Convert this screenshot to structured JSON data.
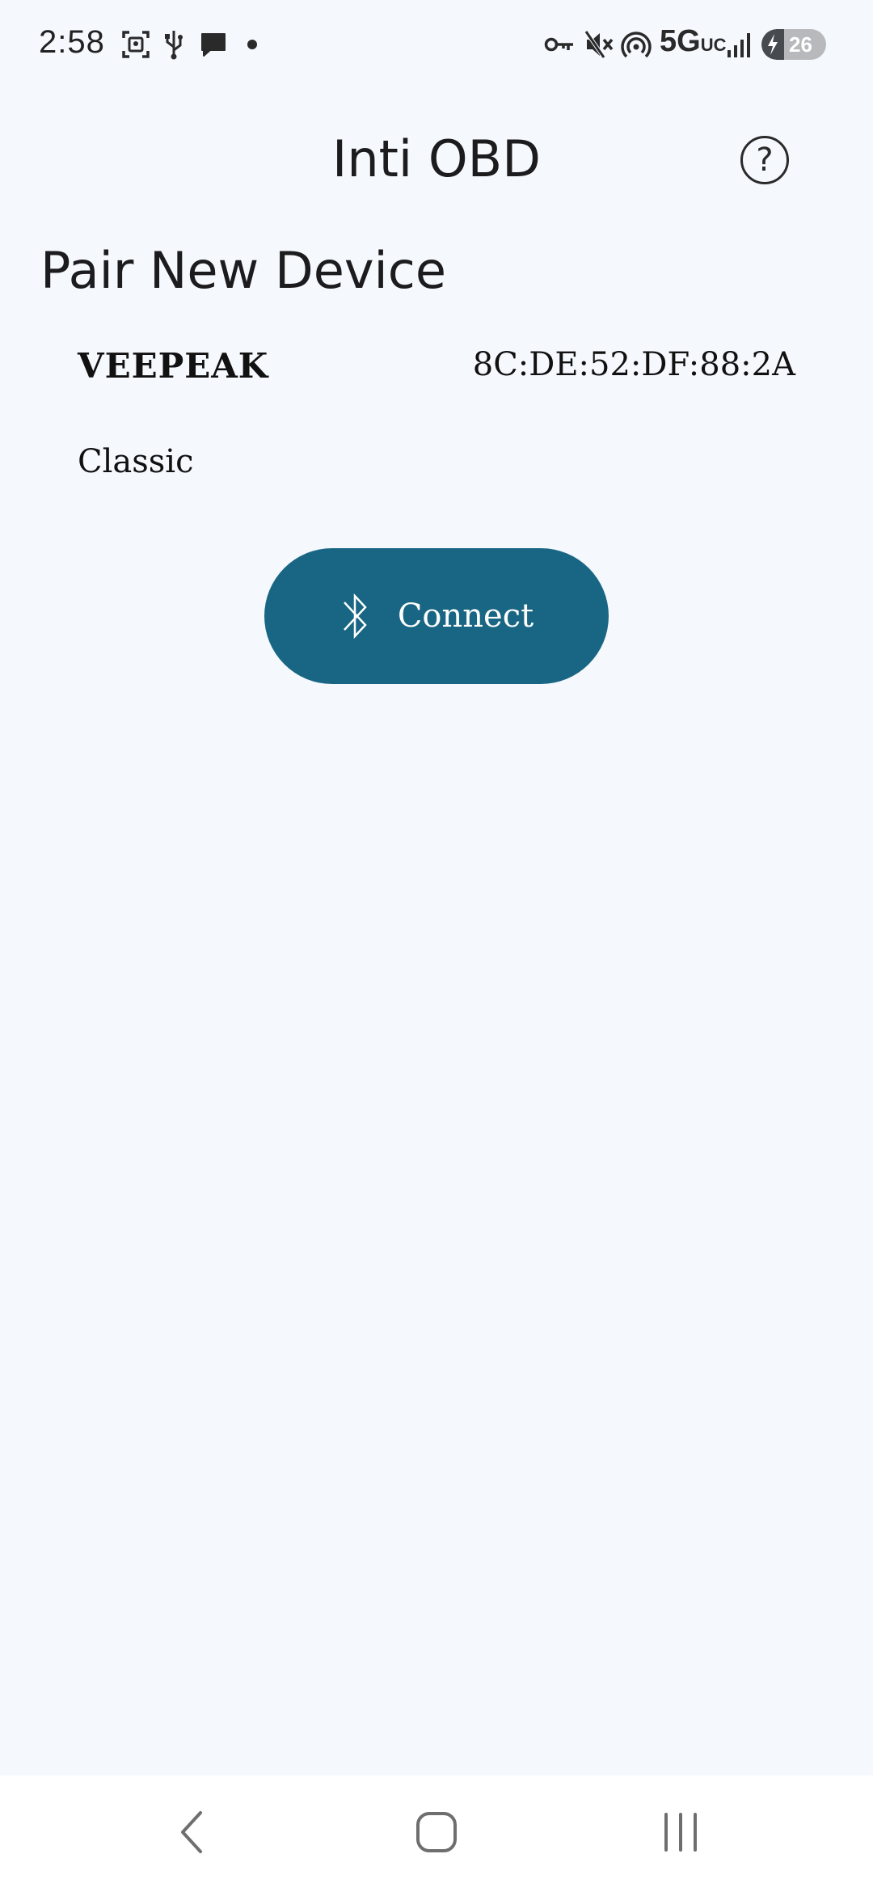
{
  "status_bar": {
    "time": "2:58",
    "network": "5G",
    "network_suffix": "UC",
    "battery_level": "26",
    "icons": [
      "screenshot-icon",
      "usb-icon",
      "chat-bubble-icon",
      "dot-icon",
      "vpn-key-icon",
      "mute-icon",
      "hotspot-icon",
      "signal-icon",
      "battery-charging-icon"
    ]
  },
  "app_bar": {
    "title": "Inti OBD",
    "help_label": "?"
  },
  "section": {
    "title": "Pair New Device"
  },
  "device": {
    "name": "VEEPEAK",
    "address": "8C:DE:52:DF:88:2A",
    "type": "Classic"
  },
  "connect_button": {
    "label": "Connect",
    "icon": "bluetooth-icon",
    "color": "#186683"
  },
  "nav_bar": {
    "back_icon": "back-icon",
    "home_icon": "home-icon",
    "recents_icon": "recents-icon"
  },
  "colors": {
    "background": "#f5f8fd",
    "accent": "#186683",
    "nav_background": "#ffffff"
  }
}
